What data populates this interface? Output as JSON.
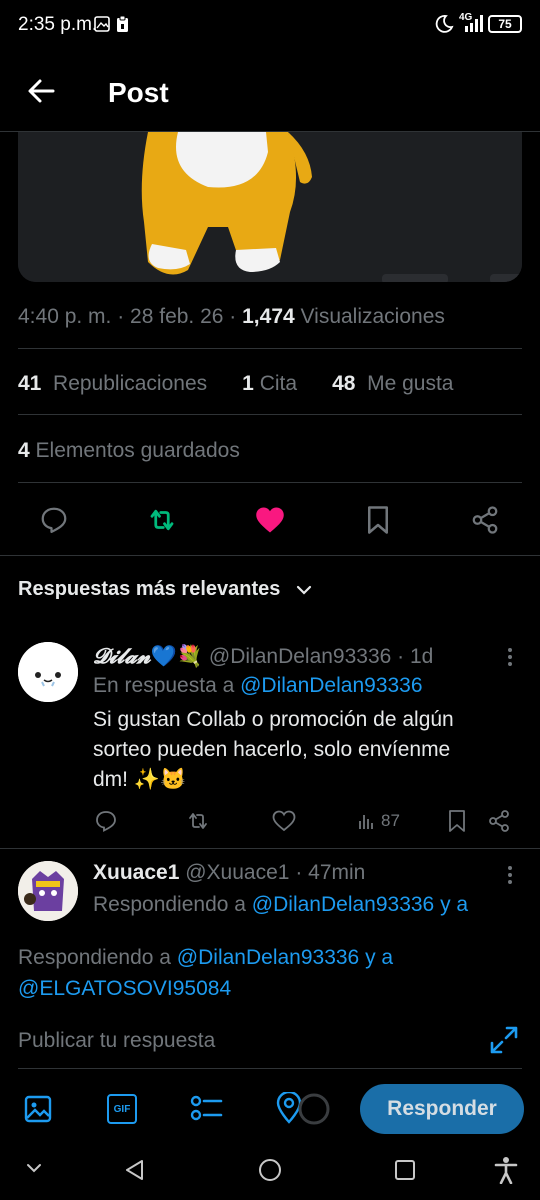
{
  "status_bar": {
    "time": "2:35 p.m.",
    "network": "4G",
    "battery": "75"
  },
  "header": {
    "title": "Post"
  },
  "post": {
    "timestamp": "4:40 p. m. · 28 feb. 26 · ",
    "views_count": "1,474",
    "views_label": " Visualizaciones",
    "reposts_count": "41",
    "reposts_label": "Republicaciones",
    "quotes_count": "1",
    "quotes_label": "Cita",
    "likes_count": "48",
    "likes_label": "Me gusta",
    "bookmarks_count": "4",
    "bookmarks_label": "Elementos guardados"
  },
  "replies_section": {
    "title": "Respuestas más relevantes"
  },
  "replies": [
    {
      "name": "𝓓𝓲𝓵𝓪𝓷",
      "emojis": "💙💐",
      "handle": "@DilanDelan93336",
      "time": "· 1d",
      "reply_prefix": "En respuesta a ",
      "reply_to": "@DilanDelan93336",
      "text_line1": "Si gustan Collab o promoción de algún",
      "text_line2": "sorteo pueden hacerlo, solo envíenme",
      "text_line3": "dm! ✨🐱",
      "views": "87"
    },
    {
      "name": "Xuuace1",
      "handle": "@Xuuace1",
      "time": "· 47min",
      "reply_prefix": "Respondiendo a ",
      "reply_to": "@DilanDelan93336 y a"
    }
  ],
  "composer": {
    "replying_prefix": "Respondiendo a ",
    "replying_to": "@DilanDelan93336",
    "replying_and": " y a",
    "replying_to2": "@ELGATOSOVI95084",
    "placeholder": "Publicar tu respuesta",
    "gif_label": "GIF",
    "reply_button": "Responder"
  },
  "colors": {
    "accent": "#1d9bf0",
    "like": "#f91880",
    "repost": "#00ba7c",
    "muted": "#71767b"
  }
}
